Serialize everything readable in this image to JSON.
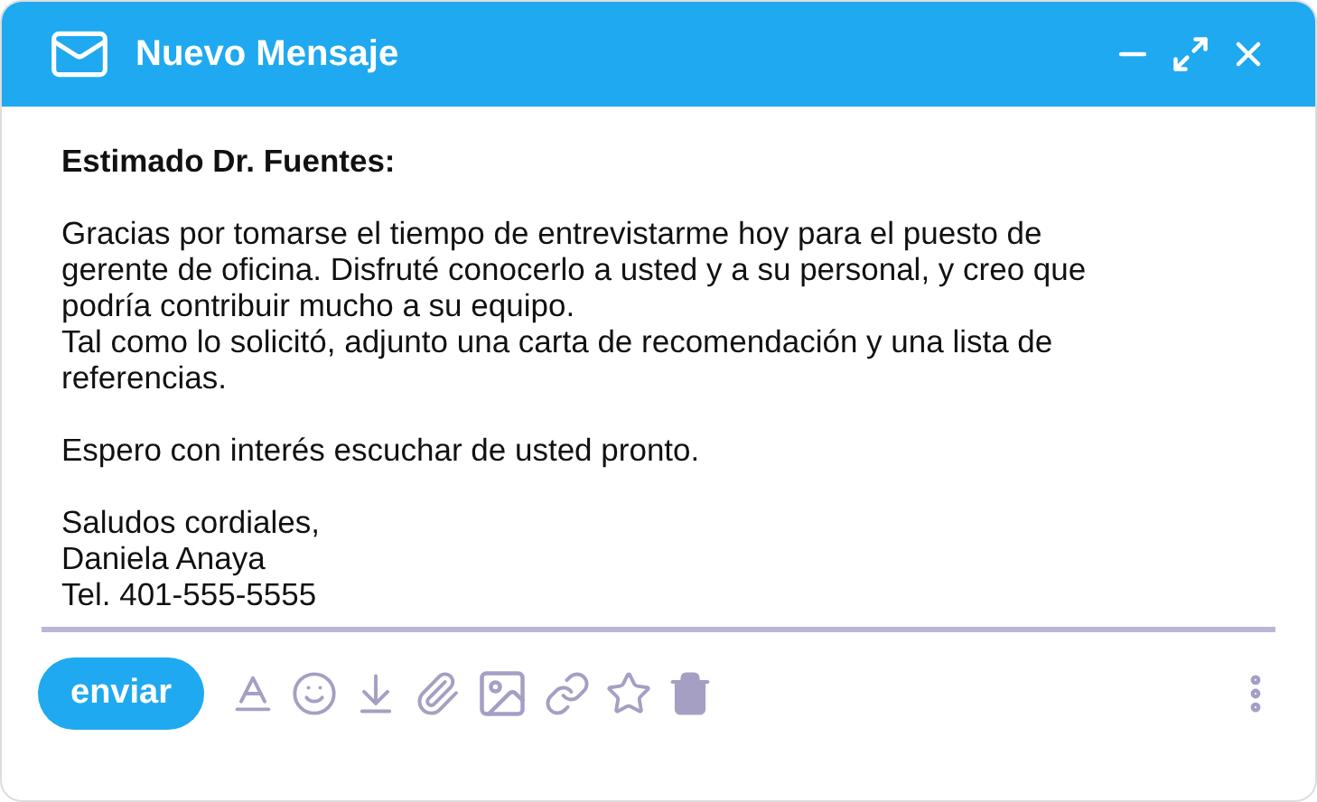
{
  "window": {
    "title": "Nuevo Mensaje"
  },
  "message": {
    "greeting": "Estimado Dr. Fuentes:",
    "paragraphs": [
      [
        "Gracias por tomarse el tiempo de entrevistarme hoy para el puesto de gerente de oficina. Disfruté conocerlo a usted y a su personal, y creo que podría contribuir mucho a su equipo.",
        "Tal como lo solicitó, adjunto una carta de recomendación y una lista de referencias."
      ],
      [
        "Espero con interés escuchar de usted pronto."
      ],
      [
        "Saludos cordiales,",
        "Daniela Anaya",
        "Tel. 401-555-5555"
      ]
    ]
  },
  "toolbar": {
    "send_button": "enviar",
    "tools": [
      {
        "kind": "format"
      },
      {
        "kind": "emoji"
      },
      {
        "kind": "download"
      },
      {
        "kind": "attach"
      },
      {
        "kind": "image"
      },
      {
        "kind": "link"
      },
      {
        "kind": "star"
      },
      {
        "kind": "trash"
      }
    ]
  }
}
